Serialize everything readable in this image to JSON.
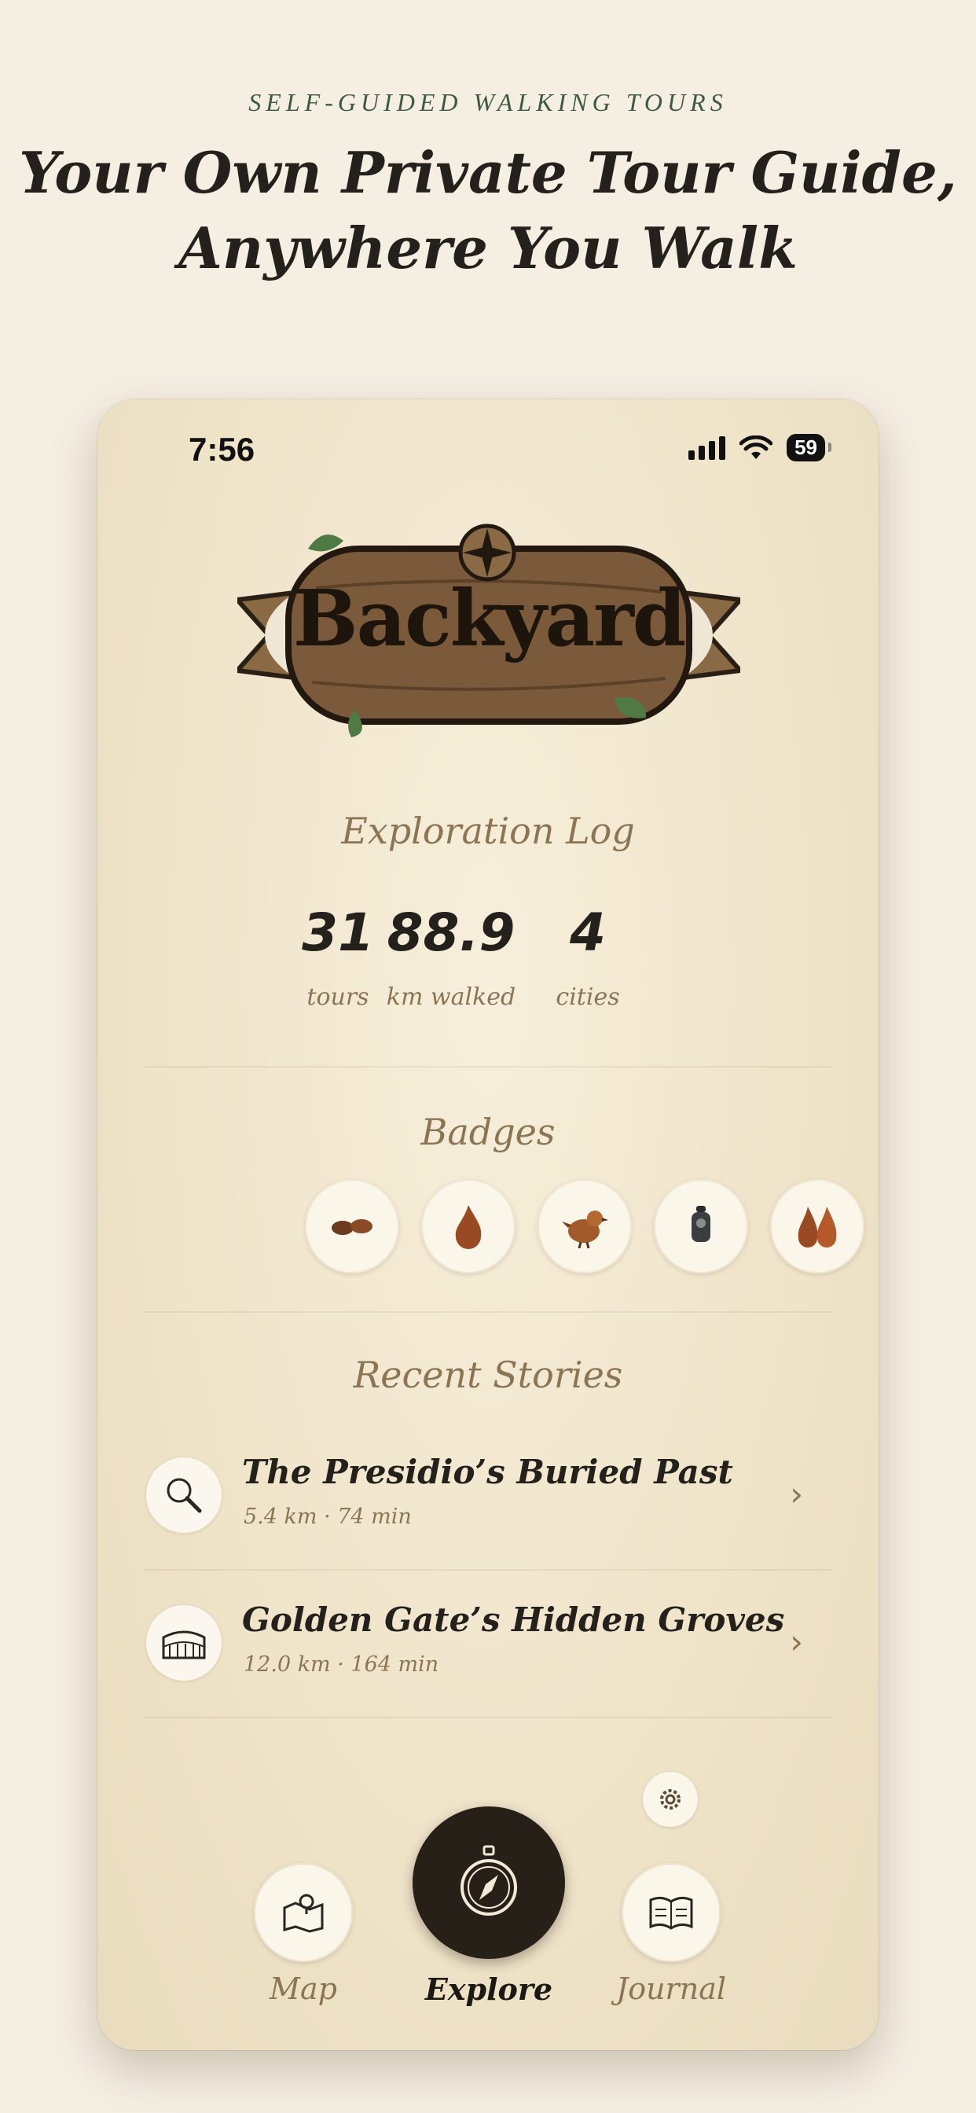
{
  "promo": {
    "eyebrow": "SELF-GUIDED WALKING TOURS",
    "headline_line1": "Your Own Private Tour Guide,",
    "headline_line2": "Anywhere You Walk"
  },
  "status_bar": {
    "time": "7:56",
    "battery": "59"
  },
  "app": {
    "logo_text": "Backyard"
  },
  "exploration_log": {
    "title": "Exploration Log",
    "stats": [
      {
        "value": "31",
        "label": "tours"
      },
      {
        "value": "88.9",
        "label": "km walked"
      },
      {
        "value": "4",
        "label": "cities"
      }
    ]
  },
  "badges": {
    "title": "Badges",
    "items": [
      {
        "icon": "sandals-icon"
      },
      {
        "icon": "flame-drop-icon"
      },
      {
        "icon": "bird-icon"
      },
      {
        "icon": "lantern-icon"
      },
      {
        "icon": "twin-flames-icon"
      }
    ]
  },
  "recent_stories": {
    "title": "Recent Stories",
    "items": [
      {
        "title": "The Presidio’s Buried Past",
        "meta": "5.4 km · 74 min",
        "icon": "magnifier-icon"
      },
      {
        "title": "Golden Gate’s Hidden Groves",
        "meta": "12.0 km · 164 min",
        "icon": "colosseum-icon"
      }
    ]
  },
  "nav": {
    "map_label": "Map",
    "explore_label": "Explore",
    "journal_label": "Journal"
  },
  "colors": {
    "page_bg": "#f5efe3",
    "ink": "#24201c",
    "muted": "#8b7553",
    "accent_green": "#3f5a42",
    "dark_button": "#272019"
  }
}
